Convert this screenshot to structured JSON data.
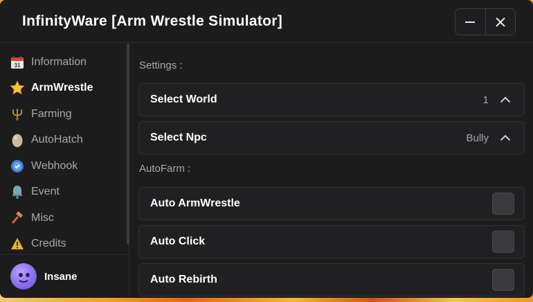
{
  "window": {
    "title": "InfinityWare [Arm Wrestle Simulator]",
    "minimize_icon": "minus-icon",
    "close_icon": "x-icon"
  },
  "sidebar": {
    "items": [
      {
        "label": "Information",
        "icon": "calendar-icon",
        "active": false
      },
      {
        "label": "ArmWrestle",
        "icon": "star-icon",
        "active": true
      },
      {
        "label": "Farming",
        "icon": "trident-icon",
        "active": false
      },
      {
        "label": "AutoHatch",
        "icon": "egg-icon",
        "active": false
      },
      {
        "label": "Webhook",
        "icon": "shield-badge-icon",
        "active": false
      },
      {
        "label": "Event",
        "icon": "bell-icon",
        "active": false
      },
      {
        "label": "Misc",
        "icon": "hammer-icon",
        "active": false
      },
      {
        "label": "Credits",
        "icon": "warning-icon",
        "active": false
      }
    ]
  },
  "profile": {
    "username": "Insane"
  },
  "main": {
    "settings_label": "Settings :",
    "select_world": {
      "label": "Select World",
      "value": "1"
    },
    "select_npc": {
      "label": "Select Npc",
      "value": "Bully"
    },
    "autofarm_label": "AutoFarm :",
    "toggles": [
      {
        "label": "Auto ArmWrestle",
        "checked": false
      },
      {
        "label": "Auto Click",
        "checked": false
      },
      {
        "label": "Auto Rebirth",
        "checked": false
      }
    ]
  },
  "colors": {
    "window_bg": "#1c1c1d",
    "row_bg": "#202022",
    "text_primary": "#ffffff",
    "text_secondary": "#a9a9ad"
  }
}
